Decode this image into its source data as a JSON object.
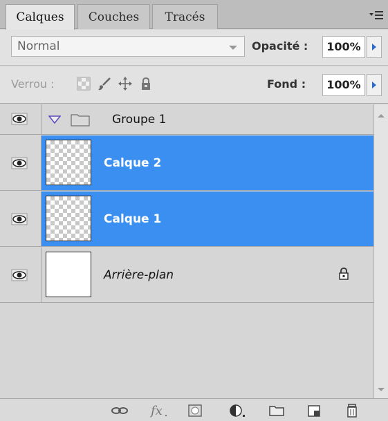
{
  "tabs": [
    {
      "label": "Calques",
      "active": true
    },
    {
      "label": "Couches",
      "active": false
    },
    {
      "label": "Tracés",
      "active": false
    }
  ],
  "panel_menu_icon": "panel-menu-icon",
  "blend_mode": {
    "value": "Normal"
  },
  "opacity": {
    "label": "Opacité :",
    "value": "100%"
  },
  "lock": {
    "label": "Verrou :",
    "icons": [
      "lock-transparency-icon",
      "lock-paint-icon",
      "lock-position-icon",
      "lock-all-icon"
    ]
  },
  "fill": {
    "label": "Fond :",
    "value": "100%"
  },
  "layers": [
    {
      "name": "Groupe 1",
      "type": "group",
      "visible": true,
      "selected": false
    },
    {
      "name": "Calque 2",
      "type": "layer",
      "visible": true,
      "selected": true,
      "thumbnail": "transparent"
    },
    {
      "name": "Calque 1",
      "type": "layer",
      "visible": true,
      "selected": true,
      "thumbnail": "transparent"
    },
    {
      "name": "Arrière-plan",
      "type": "background",
      "visible": true,
      "selected": false,
      "locked": true,
      "thumbnail": "white"
    }
  ],
  "bottom_toolbar": [
    "link-layers-icon",
    "fx-icon",
    "layer-mask-icon",
    "adjustment-layer-icon",
    "new-group-icon",
    "new-layer-icon",
    "delete-layer-icon"
  ],
  "colors": {
    "selection": "#3a8ff0",
    "panel": "#d6d6d6"
  }
}
